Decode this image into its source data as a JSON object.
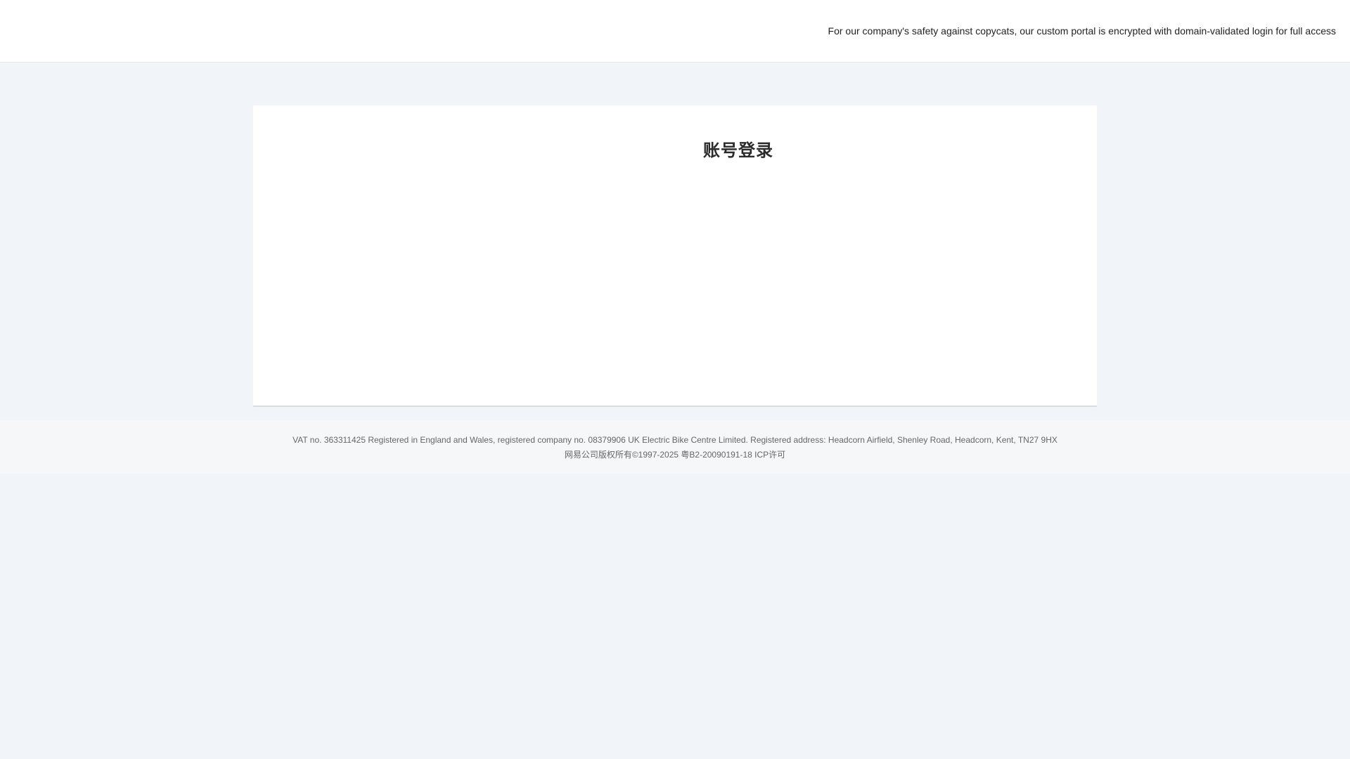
{
  "header": {
    "notice": "For our company's safety against copycats, our custom portal is encrypted with domain-validated login for full access"
  },
  "login": {
    "title": "账号登录"
  },
  "footer": {
    "registration": "VAT no. 363311425 Registered in England and Wales, registered company no. 08379906 UK Electric Bike Centre Limited. Registered address: Headcorn Airfield, Shenley Road, Headcorn, Kent, TN27 9HX",
    "copyright": "网易公司版权所有©1997-2025 粤B2-20090191-18 ICP许可"
  },
  "colors": {
    "page_background": "#f1f4f8",
    "card_background": "#ffffff",
    "footer_background": "#f6f7f8"
  }
}
